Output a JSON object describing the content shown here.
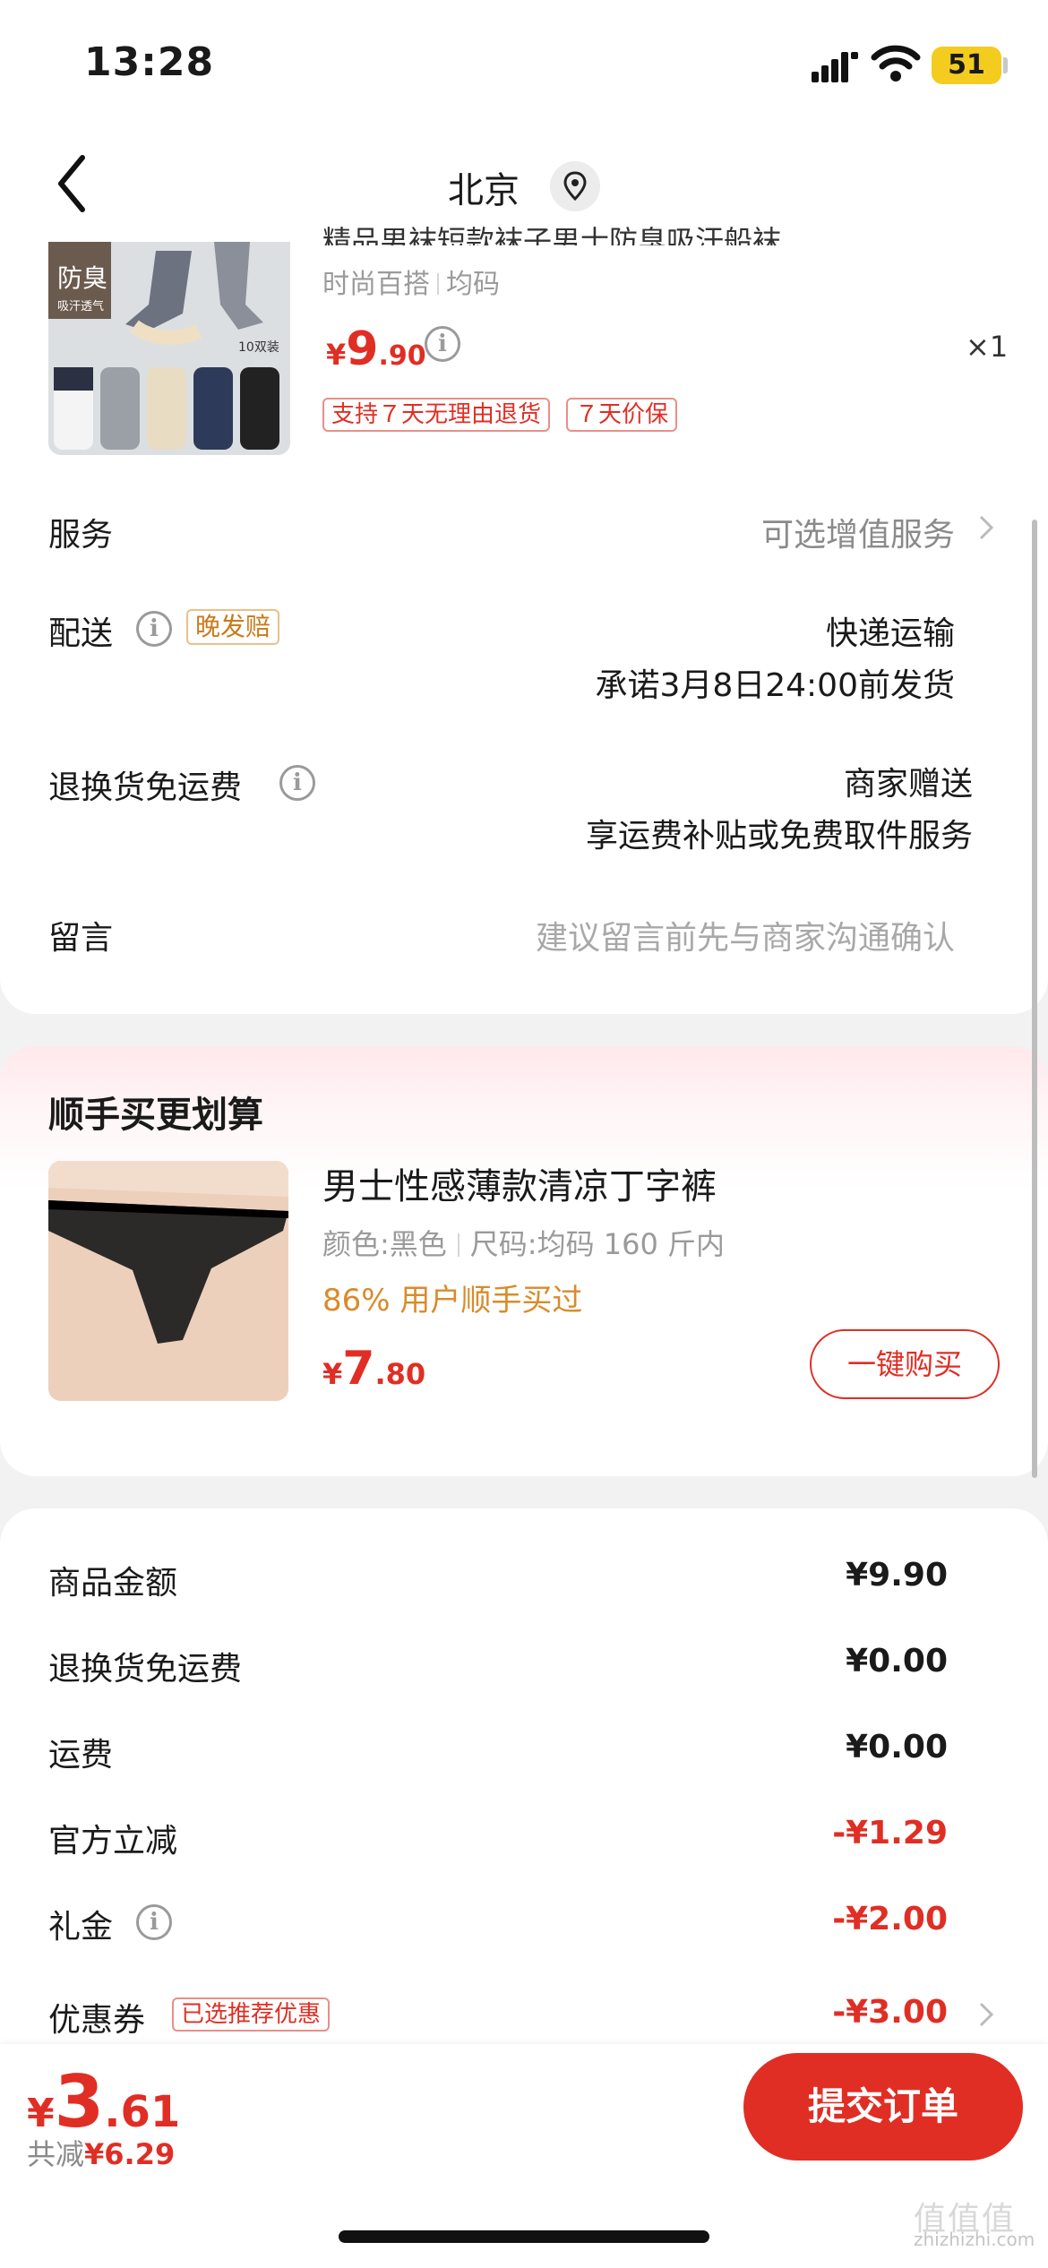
{
  "status_bar": {
    "time": "13:28",
    "battery": "51"
  },
  "nav": {
    "title": "北京"
  },
  "product": {
    "title_cut": "精品男袜短款袜子男士防臭吸汗船袜",
    "badge": "防臭",
    "badge_sub": "吸汗透气",
    "pack": "10双装",
    "spec": [
      "时尚百搭",
      "均码"
    ],
    "price_currency": "¥",
    "price_int": "9",
    "price_dec": ".90",
    "qty": "×1",
    "tags": [
      "支持７天无理由退货",
      "７天价保"
    ]
  },
  "rows": {
    "service_label": "服务",
    "service_value": "可选增值服务",
    "delivery_label": "配送",
    "delivery_tag": "晚发赔",
    "delivery_method": "快递运输",
    "delivery_promise": "承诺3月8日24:00前发货",
    "return_label": "退换货免运费",
    "return_value": "商家赠送",
    "return_desc": "享运费补贴或免费取件服务",
    "note_label": "留言",
    "note_placeholder": "建议留言前先与商家沟通确认"
  },
  "addon": {
    "section_title": "顺手买更划算",
    "name": "男士性感薄款清凉丁字裤",
    "color": "颜色:黑色",
    "size": "尺码:均码 160 斤内",
    "percent": "86% 用户顺手买过",
    "price_currency": "¥",
    "price_int": "7",
    "price_dec": ".80",
    "buy_label": "一键购买"
  },
  "summary": {
    "items": [
      {
        "label": "商品金额",
        "value": "¥9.90"
      },
      {
        "label": "退换货免运费",
        "value": "¥0.00"
      },
      {
        "label": "运费",
        "value": "¥0.00"
      },
      {
        "label": "官方立减",
        "value": "-¥1.29"
      },
      {
        "label": "礼金",
        "value": "-¥2.00"
      },
      {
        "label": "优惠券",
        "value": "-¥3.00"
      }
    ],
    "coupon_tag": "已选推荐优惠"
  },
  "bottom": {
    "currency": "¥",
    "total_int": "3",
    "total_dec": ".61",
    "saved_label": "共减",
    "saved_value": "¥6.29",
    "submit_label": "提交订单"
  },
  "watermark": {
    "logo": "值值值",
    "site": "zhizhizhi.com"
  },
  "colors": {
    "accent": "#e02e24",
    "orange": "#d98b2a",
    "background": "#f2f2f2"
  }
}
